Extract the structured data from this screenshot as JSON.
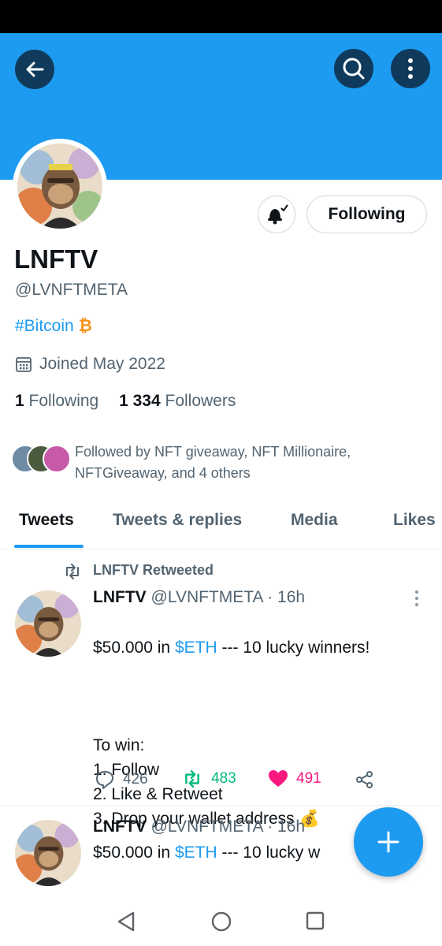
{
  "header": {
    "back_icon": "arrow-left-icon",
    "search_icon": "search-icon",
    "more_icon": "vertical-dots-icon"
  },
  "profile": {
    "display_name": "LNFTV",
    "handle": "@LVNFTMETA",
    "bio_hashtag": "#Bitcoin",
    "bio_emoji": "₿",
    "joined": "Joined May 2022",
    "following_count": "1",
    "following_label": "Following",
    "followers_count": "1 334",
    "followers_label": "Followers",
    "followed_by": "Followed by NFT giveaway, NFT Millionaire, NFTGiveaway, and 4 others",
    "follow_button_label": "Following"
  },
  "tabs": [
    {
      "label": "Tweets",
      "active": true
    },
    {
      "label": "Tweets & replies",
      "active": false
    },
    {
      "label": "Media",
      "active": false
    },
    {
      "label": "Likes",
      "active": false
    }
  ],
  "tweets": [
    {
      "retweet_label": "LNFTV Retweeted",
      "author": "LNFTV",
      "handle_time": "@LVNFTMETA · 16h",
      "line1_prefix": "$50.000 in ",
      "line1_link": "$ETH",
      "line1_suffix": " --- 10 lucky winners!",
      "body": "To win:\n1. Follow\n2. Like & Retweet\n3. Drop your wallet address 💰",
      "replies": "426",
      "retweets": "483",
      "likes": "491"
    },
    {
      "author": "LNFTV",
      "handle_time": "@LVNFTMETA · 16h",
      "line1_prefix": "$50.000 in ",
      "line1_link": "$ETH",
      "line1_suffix": " --- 10 lucky w"
    }
  ],
  "colors": {
    "accent": "#1d9bf0",
    "retweet_green": "#00ba7c",
    "like_pink": "#f91880"
  }
}
